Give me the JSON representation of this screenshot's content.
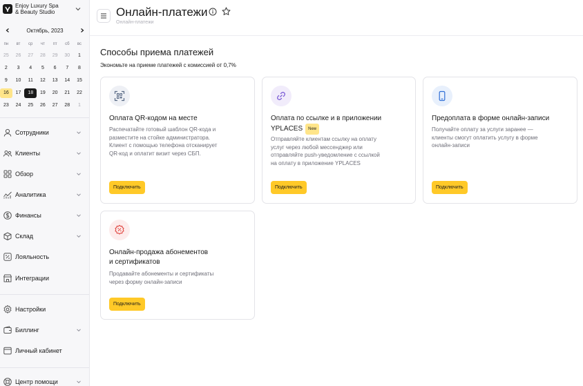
{
  "sidebar": {
    "company_line1": "Enjoy Luxury Spa",
    "company_line2": "& Beauty Studio",
    "calendar": {
      "month": "Октябрь, 2023",
      "weekdays": [
        "пн",
        "вт",
        "ср",
        "чт",
        "пт",
        "сб",
        "вс"
      ],
      "weeks": [
        [
          "25",
          "26",
          "27",
          "28",
          "29",
          "30",
          "1"
        ],
        [
          "2",
          "3",
          "4",
          "5",
          "6",
          "7",
          "8"
        ],
        [
          "9",
          "10",
          "11",
          "12",
          "13",
          "14",
          "15"
        ],
        [
          "16",
          "17",
          "18",
          "19",
          "20",
          "21",
          "22"
        ],
        [
          "23",
          "24",
          "25",
          "26",
          "27",
          "28",
          "1"
        ]
      ],
      "today": "16",
      "selected": "18"
    },
    "nav": [
      {
        "id": "staff",
        "label": "Сотрудники",
        "icon": "user-icon",
        "chevron": true
      },
      {
        "id": "clients",
        "label": "Клиенты",
        "icon": "users-icon",
        "chevron": true
      },
      {
        "id": "overview",
        "label": "Обзор",
        "icon": "grid-icon",
        "chevron": true
      },
      {
        "id": "analytics",
        "label": "Аналитика",
        "icon": "analytics-icon",
        "chevron": true
      },
      {
        "id": "finance",
        "label": "Финансы",
        "icon": "dollar-icon",
        "chevron": true
      },
      {
        "id": "warehouse",
        "label": "Склад",
        "icon": "box-icon",
        "chevron": true
      },
      {
        "id": "loyalty",
        "label": "Лояльность",
        "icon": "percent-icon",
        "chevron": false
      },
      {
        "id": "integrations",
        "label": "Интеграции",
        "icon": "store-icon",
        "chevron": false
      },
      {
        "id": "settings",
        "label": "Настройки",
        "icon": "gear-icon",
        "chevron": false
      },
      {
        "id": "billing",
        "label": "Биллинг",
        "icon": "wallet-icon",
        "chevron": true
      },
      {
        "id": "cabinet",
        "label": "Личный кабинет",
        "icon": "window-icon",
        "chevron": false
      },
      {
        "id": "help",
        "label": "Центр помощи",
        "icon": "lifebuoy-icon",
        "chevron": true
      }
    ]
  },
  "header": {
    "title": "Онлайн-платежи",
    "breadcrumb": "Онлайн-платежи"
  },
  "main": {
    "section_title": "Способы приема платежей",
    "section_subtitle": "Экономьте на приеме платежей с комиссией от 0,7%",
    "cards": [
      {
        "icon": "qr-code-icon",
        "icon_color": "#5a6b86",
        "icon_bg": "#eef0f5",
        "title_lines": [
          "Оплата QR-кодом на месте"
        ],
        "badge": "",
        "description_lines": [
          "Распечатайте готовый шаблон QR-кода и",
          "разместите на стойке администратора.",
          "Клиент с помощью телефона отсканирует",
          "QR-код и оплатит визит через СБП."
        ],
        "button": "Подключить"
      },
      {
        "icon": "link-icon",
        "icon_color": "#7b5cd6",
        "icon_bg": "#f1ecfb",
        "title_lines": [
          "Оплата по ссылке и в приложении",
          "YPLACES"
        ],
        "badge": "New",
        "description_lines": [
          "Отправляйте клиентам ссылку на оплату",
          "услуг через любой мессенджер или",
          "отправляйте push-уведомление с ссылкой",
          "на оплату в приложение YPLACES"
        ],
        "button": "Подключить"
      },
      {
        "icon": "phone-icon",
        "icon_color": "#2f6fd6",
        "icon_bg": "#e8f0fc",
        "title_lines": [
          "Предоплата в форме онлайн-записи"
        ],
        "badge": "",
        "description_lines": [
          "Получайте оплату за услуги заранее —",
          "клиенты смогут оплатить услугу в форме",
          "онлайн-записи"
        ],
        "button": "Подключить"
      },
      {
        "icon": "discount-badge-icon",
        "icon_color": "#e0443e",
        "icon_bg": "#fdecec",
        "title_lines": [
          "Онлайн-продажа абонементов",
          "и сертификатов"
        ],
        "badge": "",
        "description_lines": [
          "Продавайте абонементы и сертификаты",
          "через форму онлайн-записи"
        ],
        "button": "Подключить"
      }
    ]
  }
}
